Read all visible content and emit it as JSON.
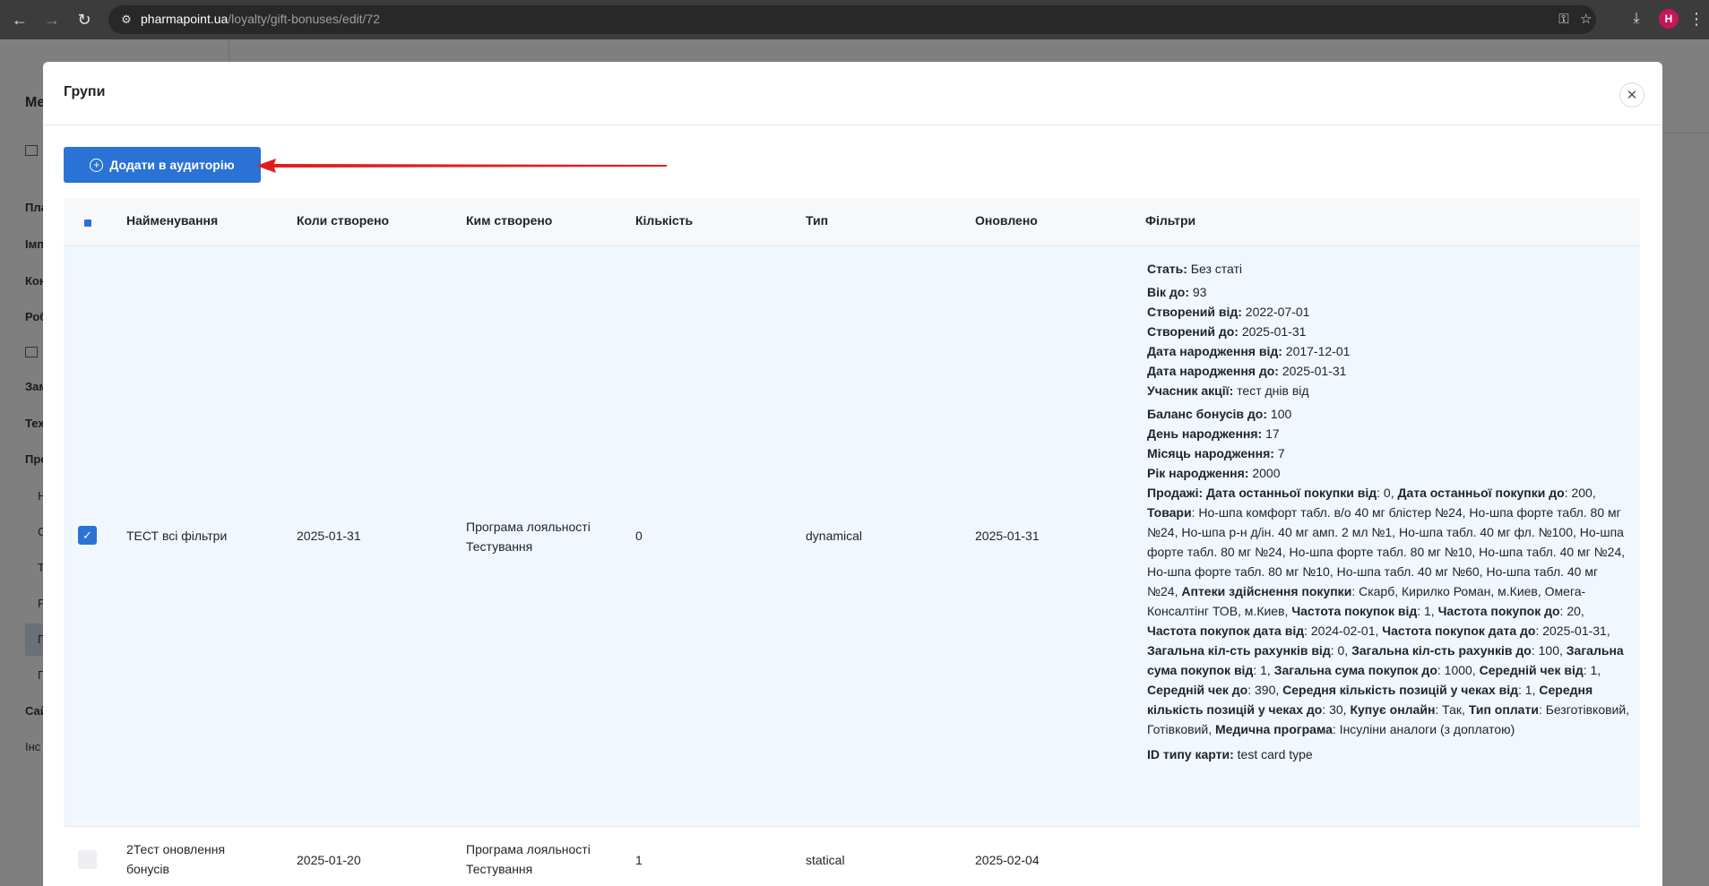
{
  "browser": {
    "url_host": "pharmapoint.ua",
    "url_path": "/loyalty/gift-bonuses/edit/72",
    "avatar_letter": "H"
  },
  "background": {
    "sidebar_items": [
      "Ме",
      "Пла",
      "Імп",
      "Кон",
      "Роб",
      "Зам",
      "Тех",
      "Про",
      "Н",
      "С",
      "Т",
      "Р",
      "П",
      "П",
      "Сай",
      "Інс"
    ]
  },
  "modal": {
    "title": "Групи",
    "add_button_label": "Додати в аудиторію",
    "columns": {
      "name": "Найменування",
      "created_at": "Коли створено",
      "created_by": "Ким створено",
      "count": "Кількість",
      "type": "Тип",
      "updated": "Оновлено",
      "filters": "Фільтри"
    },
    "rows": [
      {
        "selected": true,
        "name": "ТЕСТ всі фільтри",
        "created_at": "2025-01-31",
        "created_by_line1": "Програма лояльності",
        "created_by_line2": "Тестування",
        "count": "0",
        "type": "dynamical",
        "updated": "2025-01-31",
        "filters": [
          {
            "label": "Стать:",
            "value": " Без статі"
          },
          {
            "label": "Вік до:",
            "value": " 93"
          },
          {
            "label": "Створений від:",
            "value": " 2022-07-01"
          },
          {
            "label": "Створений до:",
            "value": " 2025-01-31"
          },
          {
            "label": "Дата народження від:",
            "value": " 2017-12-01"
          },
          {
            "label": "Дата народження до:",
            "value": " 2025-01-31"
          },
          {
            "label": "Учасник акції:",
            "value": " тест днів від"
          },
          {
            "label": "Баланс бонусів до:",
            "value": " 100"
          },
          {
            "label": "День народження:",
            "value": " 17"
          },
          {
            "label": "Місяць народження:",
            "value": " 7"
          },
          {
            "label": "Рік народження:",
            "value": " 2000"
          }
        ],
        "sales_filter": [
          {
            "b": "Продажі: Дата останньої покупки від",
            "t": ": 0, "
          },
          {
            "b": "Дата останньої покупки до",
            "t": ": 200, "
          },
          {
            "b": "Товари",
            "t": ": Но-шпа комфорт табл. в/о 40 мг блістер №24, Но-шпа форте табл. 80 мг №24, Но-шпа р-н д/ін. 40 мг амп. 2 мл №1, Но-шпа табл. 40 мг фл. №100, Но-шпа форте табл. 80 мг №24, Но-шпа форте табл. 80 мг №10, Но-шпа табл. 40 мг №24, Но-шпа форте табл. 80 мг №10, Но-шпа табл. 40 мг №60, Но-шпа табл. 40 мг №24, "
          },
          {
            "b": "Аптеки здійснення покупки",
            "t": ": Скарб, Кирилко Роман, м.Киев, Омега-Консалтінг ТОВ, м.Киев, "
          },
          {
            "b": "Частота покупок від",
            "t": ": 1, "
          },
          {
            "b": "Частота покупок до",
            "t": ": 20, "
          },
          {
            "b": "Частота покупок дата від",
            "t": ": 2024-02-01, "
          },
          {
            "b": "Частота покупок дата до",
            "t": ": 2025-01-31, "
          },
          {
            "b": "Загальна кіл-сть рахунків від",
            "t": ": 0, "
          },
          {
            "b": "Загальна кіл-сть рахунків до",
            "t": ": 100, "
          },
          {
            "b": "Загальна сума покупок від",
            "t": ": 1, "
          },
          {
            "b": "Загальна сума покупок до",
            "t": ": 1000, "
          },
          {
            "b": "Середній чек від",
            "t": ": 1, "
          },
          {
            "b": "Середній чек до",
            "t": ": 390, "
          },
          {
            "b": "Середня кількість позицій у чеках від",
            "t": ": 1, "
          },
          {
            "b": "Середня кількість позицій у чеках до",
            "t": ": 30, "
          },
          {
            "b": "Купує онлайн",
            "t": ": Так, "
          },
          {
            "b": "Тип оплати",
            "t": ": Безготівковий, Готівковий, "
          },
          {
            "b": "Медична програма",
            "t": ": Інсуліни аналоги (з доплатою)"
          }
        ],
        "card_type_label": "ID типу карти:",
        "card_type_value": " test card type"
      },
      {
        "selected": false,
        "name_line1": "2Тест оновлення",
        "name_line2": "бонусів",
        "created_at": "2025-01-20",
        "created_by_line1": "Програма лояльності",
        "created_by_line2": "Тестування",
        "count": "1",
        "type": "statical",
        "updated": "2025-02-04"
      }
    ]
  },
  "colors": {
    "primary": "#2a72d4",
    "selected_row": "#f0f7ff",
    "annotation_arrow": "#e01e1e"
  }
}
